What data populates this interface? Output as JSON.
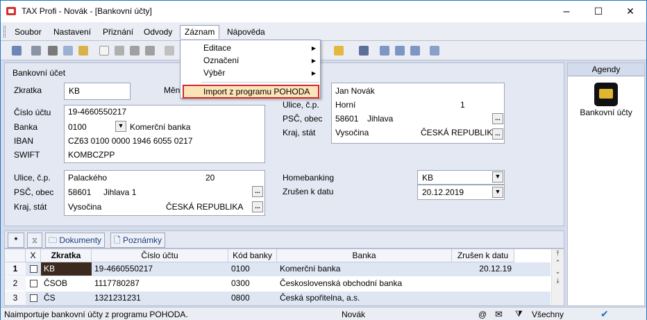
{
  "window": {
    "title": "TAX Profi - Novák - [Bankovní účty]",
    "minimize": "–",
    "maximize": "☐",
    "close": "✕"
  },
  "menubar": {
    "items": [
      {
        "label": "Soubor",
        "name": "menu-soubor"
      },
      {
        "label": "Nastavení",
        "name": "menu-nastaveni"
      },
      {
        "label": "Přiznání",
        "name": "menu-priznani"
      },
      {
        "label": "Odvody",
        "name": "menu-odvody"
      },
      {
        "label": "Záznam",
        "name": "menu-zaznam"
      },
      {
        "label": "Nápověda",
        "name": "menu-napoveda"
      }
    ]
  },
  "dropdown": {
    "items": [
      {
        "label": "Editace",
        "submenu": true
      },
      {
        "label": "Označení",
        "submenu": true
      },
      {
        "label": "Výběr",
        "submenu": true
      },
      {
        "label": "Import z programu POHODA",
        "submenu": false
      }
    ]
  },
  "form": {
    "section_title": "Bankovní účet",
    "zkratka_label": "Zkratka",
    "zkratka_value": "KB",
    "mena_label": "Měn",
    "cislo_label": "Číslo účtu",
    "cislo_value": "19-4660550217",
    "banka_label": "Banka",
    "banka_code": "0100",
    "banka_name": "Komerční banka",
    "iban_label": "IBAN",
    "iban_value": "CZ63 0100 0000 1946 6055 0217",
    "swift_label": "SWIFT",
    "swift_value": "KOMBCZPP",
    "ulice_label": "Ulice, č.p.",
    "ulice_value": "Palackého",
    "ulice_no": "20",
    "psc_label": "PSČ, obec",
    "psc_value": "58601",
    "obec_value": "Jihlava 1",
    "kraj_label": "Kraj, stát",
    "kraj_value": "Vysočina",
    "stat_value": "ČESKÁ REPUBLIKA",
    "owner_name": "Jan Novák",
    "o_ulice_label": "Ulice, č.p.",
    "o_ulice_value": "Horní",
    "o_ulice_no": "1",
    "o_psc_label": "PSČ, obec",
    "o_psc_value": "58601",
    "o_obec_value": "Jihlava",
    "o_kraj_label": "Kraj, stát",
    "o_kraj_value": "Vysočina",
    "o_stat_value": "ČESKÁ REPUBLIKA",
    "homebanking_label": "Homebanking",
    "homebanking_value": "KB",
    "zrusen_label": "Zrušen k datu",
    "zrusen_value": "20.12.2019",
    "ellipsis": "..."
  },
  "agendy": {
    "header": "Agendy",
    "item_label": "Bankovní účty"
  },
  "tabs": {
    "star": "*",
    "dokumenty": "Dokumenty",
    "poznamky": "Poznámky"
  },
  "grid": {
    "headers": {
      "x": "X",
      "zkratka": "Zkratka",
      "cislo": "Číslo účtu",
      "kod": "Kód banky",
      "banka": "Banka",
      "zrusen": "Zrušen k datu"
    },
    "rows": [
      {
        "n": "1",
        "zkratka": "KB",
        "cislo": "19-4660550217",
        "kod": "0100",
        "banka": "Komerční banka",
        "zrusen": "20.12.19"
      },
      {
        "n": "2",
        "zkratka": "ČSOB",
        "cislo": "1117780287",
        "kod": "0300",
        "banka": "Československá obchodní banka",
        "zrusen": ""
      },
      {
        "n": "3",
        "zkratka": "ČS",
        "cislo": "1321231231",
        "kod": "0800",
        "banka": "Česká spořitelna, a.s.",
        "zrusen": ""
      }
    ]
  },
  "status": {
    "message": "Naimportuje bankovní účty z programu POHODA.",
    "user": "Novák",
    "at": "@",
    "filter": "Všechny"
  },
  "colors": {
    "accent": "#1d75c4",
    "highlight_border": "#d2262c",
    "selected_cell": "#3c2a1e"
  }
}
